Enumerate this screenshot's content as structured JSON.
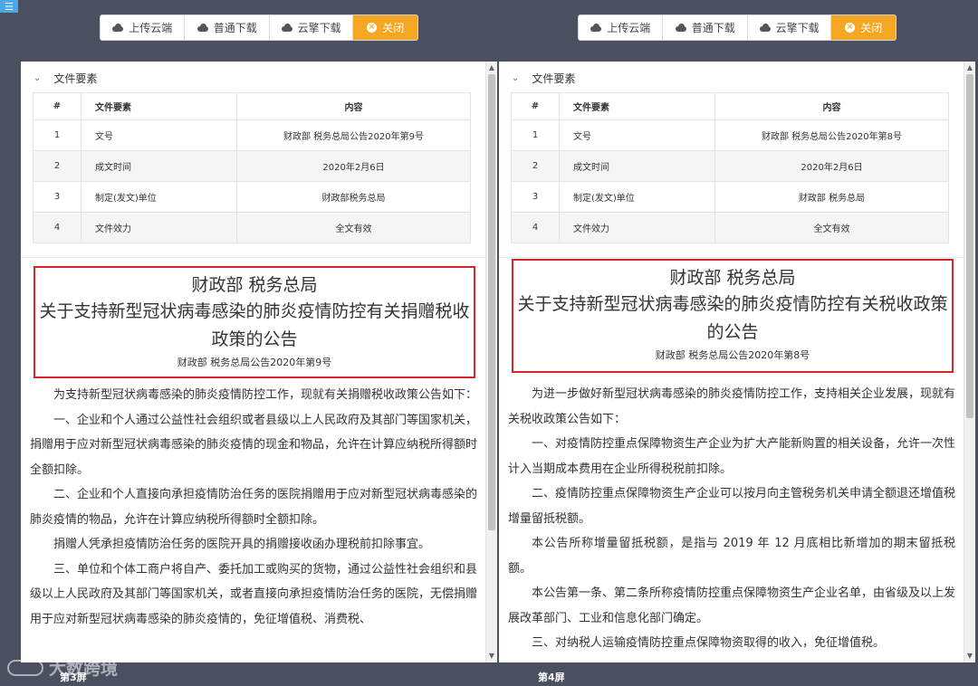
{
  "toolbar": {
    "upload": "上传云端",
    "normal_download": "普通下载",
    "cloud_download": "云擎下载",
    "close": "关闭"
  },
  "table_headers": {
    "num": "#",
    "element": "文件要素",
    "content": "内容"
  },
  "left": {
    "section_title": "文件要素",
    "rows": [
      {
        "num": "1",
        "element": "文号",
        "content": "财政部 税务总局公告2020年第9号"
      },
      {
        "num": "2",
        "element": "成文时间",
        "content": "2020年2月6日"
      },
      {
        "num": "3",
        "element": "制定(发文)单位",
        "content": "财政部税务总局"
      },
      {
        "num": "4",
        "element": "文件效力",
        "content": "全文有效"
      }
    ],
    "title_line1": "财政部 税务总局",
    "title_line2": "关于支持新型冠状病毒感染的肺炎疫情防控有关捐赠税收政策的公告",
    "doc_number": "财政部 税务总局公告2020年第9号",
    "paragraphs": [
      "为支持新型冠状病毒感染的肺炎疫情防控工作，现就有关捐赠税收政策公告如下：",
      "一、企业和个人通过公益性社会组织或者县级以上人民政府及其部门等国家机关，捐赠用于应对新型冠状病毒感染的肺炎疫情的现金和物品，允许在计算应纳税所得额时全额扣除。",
      "二、企业和个人直接向承担疫情防治任务的医院捐赠用于应对新型冠状病毒感染的肺炎疫情的物品，允许在计算应纳税所得额时全额扣除。",
      "捐赠人凭承担疫情防治任务的医院开具的捐赠接收函办理税前扣除事宜。",
      "三、单位和个体工商户将自产、委托加工或购买的货物，通过公益性社会组织和县级以上人民政府及其部门等国家机关，或者直接向承担疫情防治任务的医院，无偿捐赠用于应对新型冠状病毒感染的肺炎疫情的，免征增值税、消费税、"
    ],
    "screen_label": "第3屏"
  },
  "right": {
    "section_title": "文件要素",
    "rows": [
      {
        "num": "1",
        "element": "文号",
        "content": "财政部 税务总局公告2020年第8号"
      },
      {
        "num": "2",
        "element": "成文时间",
        "content": "2020年2月6日"
      },
      {
        "num": "3",
        "element": "制定(发文)单位",
        "content": "财政部 税务总局"
      },
      {
        "num": "4",
        "element": "文件效力",
        "content": "全文有效"
      }
    ],
    "title_line1": "财政部 税务总局",
    "title_line2": "关于支持新型冠状病毒感染的肺炎疫情防控有关税收政策的公告",
    "doc_number": "财政部 税务总局公告2020年第8号",
    "paragraphs": [
      "为进一步做好新型冠状病毒感染的肺炎疫情防控工作，支持相关企业发展，现就有关税收政策公告如下：",
      "一、对疫情防控重点保障物资生产企业为扩大产能新购置的相关设备，允许一次性计入当期成本费用在企业所得税税前扣除。",
      "二、疫情防控重点保障物资生产企业可以按月向主管税务机关申请全额退还增值税增量留抵税额。",
      "本公告所称增量留抵税额，是指与 2019 年 12 月底相比新增加的期末留抵税额。",
      "本公告第一条、第二条所称疫情防控重点保障物资生产企业名单，由省级及以上发展改革部门、工业和信息化部门确定。",
      "三、对纳税人运输疫情防控重点保障物资取得的收入，免征增值税。"
    ],
    "screen_label": "第4屏"
  },
  "watermark": "大数跨境"
}
